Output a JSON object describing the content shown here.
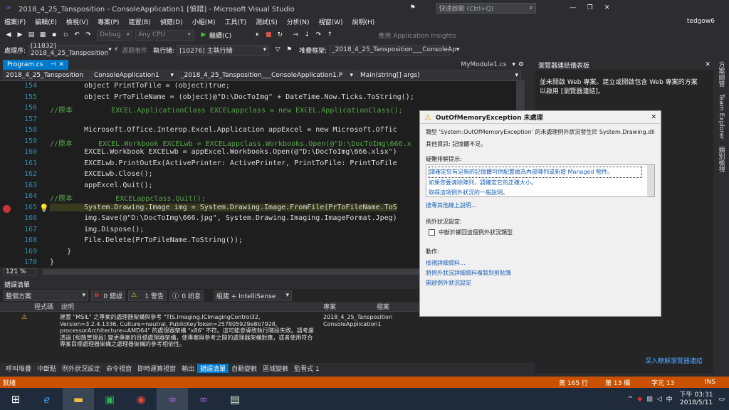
{
  "window": {
    "title": "2018_4_25_Tansposition - ConsoleApplication1 [偵錯] - Microsoft Visual Studio",
    "quick_launch": "快速啟動 (Ctrl+Q)",
    "user": "tedgow6",
    "controls": [
      "—",
      "❐",
      "✕"
    ]
  },
  "menu": [
    "檔案(F)",
    "編輯(E)",
    "檢視(V)",
    "專案(P)",
    "建置(B)",
    "偵錯(D)",
    "小組(M)",
    "工具(T)",
    "測試(S)",
    "分析(N)",
    "視窗(W)",
    "說明(H)"
  ],
  "toolbar": {
    "config": "Debug",
    "platform": "Any CPU",
    "continue_label": "繼續(C)",
    "insights": "應用 Application Insights"
  },
  "toolbar2": {
    "process_label": "處理序:",
    "process_value": "[11832] 2018_4_25_Tansposition",
    "lifecycle_label": "週期事件",
    "thread_label": "執行緒:",
    "thread_value": "[10276] 主執行緒",
    "stack_label": "堆疊框架:",
    "stack_value": "_2018_4_25_Tansposition___ConsoleAp"
  },
  "tabs": {
    "active": "Program.cs",
    "right": "MyModule1.cs"
  },
  "nav": {
    "project": "2018_4_25_Tansposition",
    "scope": "ConsoleApplication1",
    "type": "_2018_4_25_Tansposition___ConsoleApplication1.P",
    "member": "Main(string[] args)"
  },
  "editor": {
    "zoom": "121 %",
    "lines": [
      {
        "n": "154",
        "t": "        object PrintToFile = (object)true;"
      },
      {
        "n": "155",
        "t": "        object PrToFileName = (object)@\"D:\\DocToImg\" + DateTime.Now.Ticks.ToString();"
      },
      {
        "n": "156",
        "t": "//原本         EXCEL.ApplicationClass EXCELappclass = new EXCEL.ApplicationClass();"
      },
      {
        "n": "157",
        "t": ""
      },
      {
        "n": "158",
        "t": "        Microsoft.Office.Interop.Excel.Application appExcel = new Microsoft.Offic"
      },
      {
        "n": "159",
        "t": "//原本      EXCEL.Workbook EXCELwb = EXCELappclass.Workbooks.Open(@\"D:\\DocToImg\\666.x"
      },
      {
        "n": "160",
        "t": "        EXCEL.Workbook EXCELwb = appExcel.Workbooks.Open(@\"D:\\DocToImg\\666.xlsx\")"
      },
      {
        "n": "161",
        "t": "        EXCELwb.PrintOutEx(ActivePrinter: ActivePrinter, PrintToFile: PrintToFile"
      },
      {
        "n": "162",
        "t": "        EXCELwb.Close();"
      },
      {
        "n": "163",
        "t": "        appExcel.Quit();"
      },
      {
        "n": "164",
        "t": "//原本          EXCELappclass.Quit();"
      },
      {
        "n": "165",
        "t": "        System.Drawing.Image img = System.Drawing.Image.FromFile(PrToFileName.ToS"
      },
      {
        "n": "166",
        "t": "        img.Save(@\"D:\\DocToImg\\666.jpg\", System.Drawing.Imaging.ImageFormat.Jpeg)"
      },
      {
        "n": "167",
        "t": "        img.Dispose();"
      },
      {
        "n": "168",
        "t": "        File.Delete(PrToFileName.ToString());"
      },
      {
        "n": "169",
        "t": "    }"
      },
      {
        "n": "170",
        "t": "}"
      }
    ]
  },
  "exception": {
    "title": "OutOfMemoryException 未處理",
    "type_text": "類型 'System.OutOfMemoryException' 的未處理例外狀況發生於 System.Drawing.dll",
    "extra": "其他資訊: 記憶體不足。",
    "troubleshoot_header": "疑難排解提示:",
    "tips": [
      "請確定您有足夠的記憶體可供配置做為內部陣列或新增 Managed 物件。",
      "如果您要清除陣列，請確定它的正確大小。",
      "取得這項例外狀況的一般說明。"
    ],
    "search_more": "搜尋其他線上說明...",
    "settings_header": "例外狀況設定:",
    "break_check": "中斷於擲回這個例外狀況類型",
    "actions_header": "動作:",
    "actions": [
      "檢視詳細資料...",
      "將例外狀況詳細資料複製到剪貼簿",
      "開啟例外狀況設定"
    ]
  },
  "right_panel": {
    "title": "瀏覽器連結儀表板",
    "text": "並未開啟 Web 專案。建立或開啟包含 Web 專案的方案以啟用 [瀏覽器連結]。",
    "link": "深入瞭解瀏覽器連結"
  },
  "sidebar": [
    "方案總管",
    "Team Explorer",
    "類別檢視"
  ],
  "errors": {
    "title": "錯誤清單",
    "scope": "整個方案",
    "errors_count": "0 錯誤",
    "warnings_count": "1 警告",
    "messages_count": "0 訊息",
    "build_filter": "組建 + IntelliSense",
    "columns": [
      "程式碼",
      "說明",
      "專案",
      "檔案"
    ],
    "row": {
      "desc": "建置 \"MSIL\" 之專案的處理器架構與參考 \"TIS.Imaging.ICImagingControl32, Version=3.2.4.1336, Culture=neutral, PublicKeyToken=257805929e8b7928, processorArchitecture=AMD64\" 的處理器架構 \"x86\" 不符。這可能會導致執行階段失敗。請考慮透過 [組態管理員] 變更專案的目標處理器架構，使專案與參考之間的處理器架構對應，或者使用符合專案目標處理器架構之處理器架構的參考相依性。",
      "project": "2018_4_25_Tansposition ConsoleApplication1"
    }
  },
  "bottom_tabs": [
    "呼叫堆疊",
    "中斷點",
    "例外狀況設定",
    "命令視窗",
    "即時運算視窗",
    "輸出",
    "錯誤清單",
    "自動變數",
    "區域變數",
    "監看式 1"
  ],
  "status": {
    "text": "就緒",
    "line": "第 165 行",
    "col": "第 13 欄",
    "char": "字元 13",
    "ins": "INS"
  },
  "taskbar": {
    "time": "下午 03:31",
    "date": "2018/5/11",
    "lang": "中"
  }
}
